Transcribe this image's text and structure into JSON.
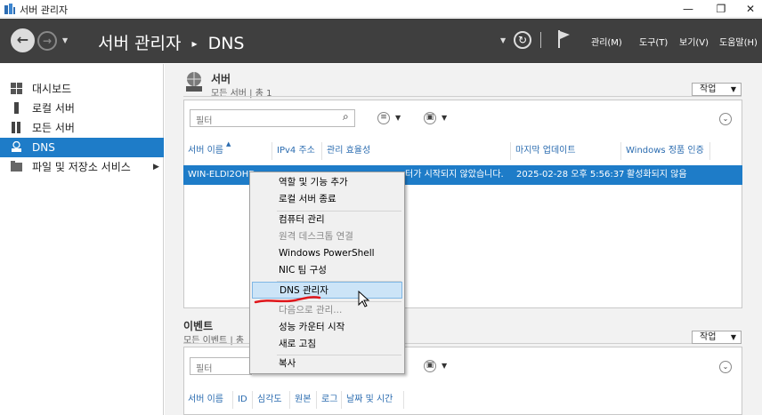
{
  "window": {
    "title": "서버 관리자"
  },
  "header": {
    "crumb_root": "서버 관리자",
    "crumb_sep": "▸",
    "crumb_page": "DNS",
    "menus": [
      "관리(M)",
      "도구(T)",
      "보기(V)",
      "도움말(H)"
    ]
  },
  "sidebar": {
    "items": [
      {
        "label": "대시보드",
        "icon": "dashboard-icon"
      },
      {
        "label": "로컬 서버",
        "icon": "local-server-icon"
      },
      {
        "label": "모든 서버",
        "icon": "all-servers-icon"
      },
      {
        "label": "DNS",
        "icon": "dns-icon"
      },
      {
        "label": "파일 및 저장소 서비스",
        "icon": "file-storage-icon"
      }
    ],
    "selected_index": 3
  },
  "servers": {
    "title": "서버",
    "subtitle": "모든 서버 | 총 1",
    "tasks_label": "작업",
    "filter_placeholder": "필터",
    "columns": [
      "서버 이름",
      "IPv4 주소",
      "관리 효율성",
      "마지막 업데이트",
      "Windows 정품 인증"
    ],
    "row": {
      "name": "WIN-ELDI2OHD",
      "status": "터가 시작되지 않았습니다.",
      "updated": "2025-02-28 오후 5:56:37",
      "activation": "활성화되지 않음"
    }
  },
  "events": {
    "title": "이벤트",
    "subtitle": "모든 이벤트 | 총",
    "tasks_label": "작업",
    "filter_placeholder": "필터",
    "columns": [
      "서버 이름",
      "ID",
      "심각도",
      "원본",
      "로그",
      "날짜 및 시간"
    ]
  },
  "context_menu": {
    "items": [
      {
        "label": "역할 및 기능 추가",
        "disabled": false
      },
      {
        "label": "로컬 서버 종료",
        "disabled": false
      },
      {
        "label": "컴퓨터 관리",
        "disabled": false
      },
      {
        "label": "원격 데스크톱 연결",
        "disabled": true
      },
      {
        "label": "Windows PowerShell",
        "disabled": false
      },
      {
        "label": "NIC 팀 구성",
        "disabled": false
      },
      {
        "label": "DNS 관리자",
        "disabled": false,
        "highlighted": true
      },
      {
        "label": "다음으로 관리...",
        "disabled": true
      },
      {
        "label": "성능 카운터 시작",
        "disabled": false
      },
      {
        "label": "새로 고침",
        "disabled": false
      },
      {
        "label": "복사",
        "disabled": false
      }
    ]
  },
  "colors": {
    "header_bg": "#3f3f3f",
    "selection": "#1e7cc8",
    "annotation": "#e0161b"
  }
}
